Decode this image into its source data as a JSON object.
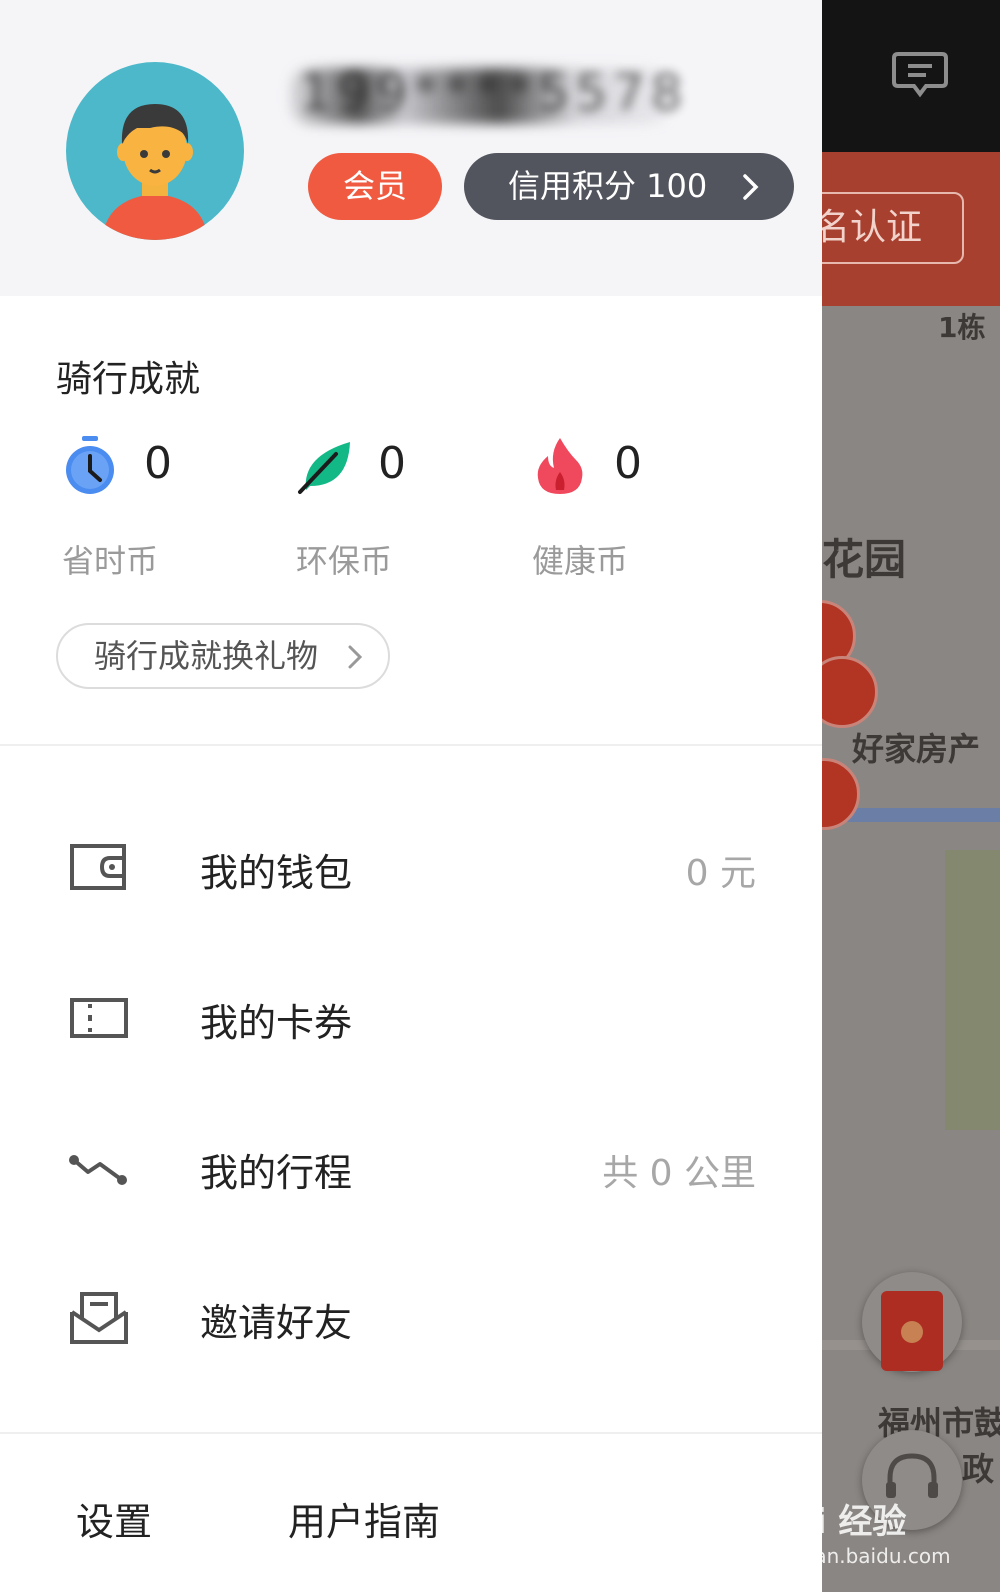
{
  "profile": {
    "phone_masked": "199****5578",
    "vip_label": "会员",
    "credit_label": "信用积分 100"
  },
  "achievements": {
    "title": "骑行成就",
    "items": [
      {
        "value": "0",
        "name": "省时币",
        "icon": "stopwatch-icon",
        "color": "#4b8cf0"
      },
      {
        "value": "0",
        "name": "环保币",
        "icon": "leaf-icon",
        "color": "#12b886"
      },
      {
        "value": "0",
        "name": "健康币",
        "icon": "flame-icon",
        "color": "#f0485c"
      }
    ],
    "gift_button": "骑行成就换礼物"
  },
  "menu": [
    {
      "label": "我的钱包",
      "meta": "0 元",
      "icon": "wallet-icon"
    },
    {
      "label": "我的卡券",
      "meta": "",
      "icon": "coupon-icon"
    },
    {
      "label": "我的行程",
      "meta": "共 0 公里",
      "icon": "trip-line-icon"
    },
    {
      "label": "邀请好友",
      "meta": "",
      "icon": "invite-envelope-icon"
    }
  ],
  "footer": {
    "settings": "设置",
    "guide": "用户指南"
  },
  "map_overlay": {
    "verify_button": "名认证",
    "labels": {
      "building": "1栋",
      "garden": "花园",
      "realty": "好家房产",
      "city1": "福州市鼓",
      "city2": "政"
    },
    "watermark_main": "Bai 经验",
    "watermark_sub": "jingyan.baidu.com"
  },
  "colors": {
    "accent_red": "#ef5a40",
    "credit_dark": "#52555e"
  }
}
